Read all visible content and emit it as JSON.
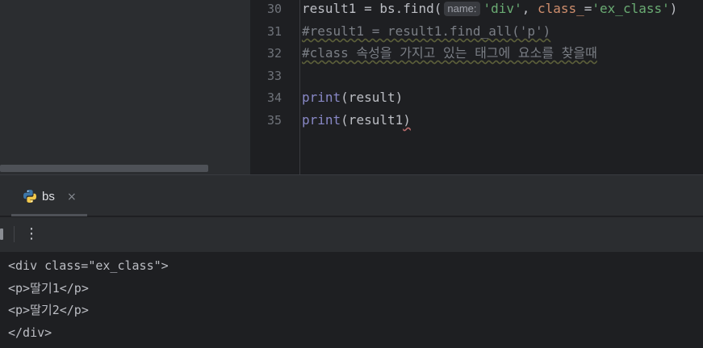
{
  "editor": {
    "line_numbers": [
      "30",
      "31",
      "32",
      "33",
      "34",
      "35"
    ],
    "line30": {
      "prefix": "result1 = bs.find(",
      "hint": "name:",
      "arg1": "'div'",
      "sep": ", ",
      "kwarg": "class_",
      "eq": "=",
      "arg2": "'ex_class'",
      "suffix": ")"
    },
    "line31": "#result1 = result1.find_all('p')",
    "line32": "#class 속성을 가지고 있는 태그에 요소를 찾을때",
    "line34": {
      "fn": "print",
      "args": "(result)"
    },
    "line35": {
      "fn": "print",
      "args_main": "(result1",
      "args_end": ")"
    }
  },
  "run_panel": {
    "tab_label": "bs",
    "close_glyph": "×",
    "more_glyph": "⋮",
    "tab_icon": "python-icon"
  },
  "console": {
    "lines": [
      "<div class=\"ex_class\">",
      "<p>딸기1</p>",
      "<p>딸기2</p>",
      "</div>"
    ]
  },
  "colors": {
    "background": "#1e1f22",
    "panel": "#2b2d30",
    "string": "#6aab73",
    "keyword_arg": "#cf8e6d",
    "builtin": "#8888c6",
    "comment": "#7a7e85",
    "text": "#bcbec4",
    "python_blue": "#3d76a8",
    "python_yellow": "#f2c94c"
  }
}
